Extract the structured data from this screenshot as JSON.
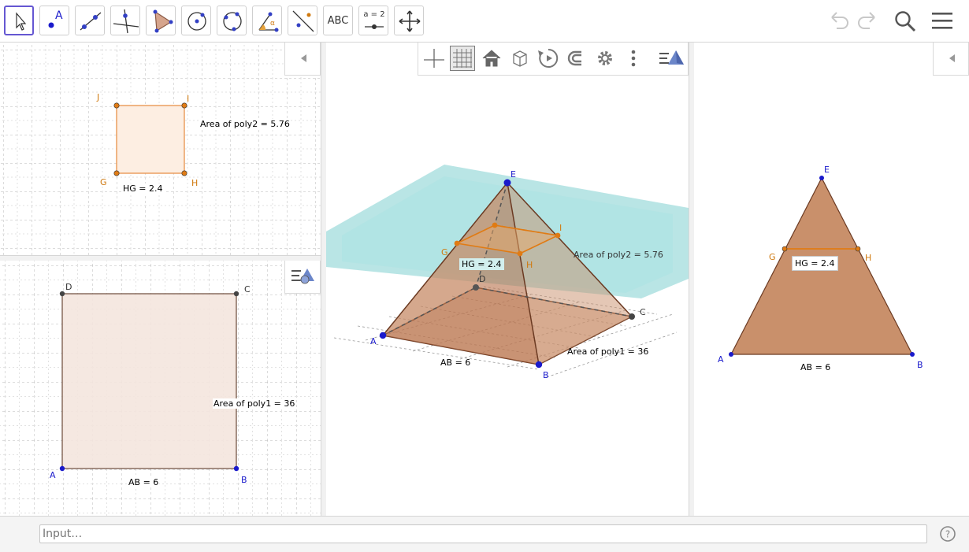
{
  "toolbar": {
    "tools": [
      {
        "name": "move-tool"
      },
      {
        "name": "point-tool",
        "label": "A"
      },
      {
        "name": "line-tool"
      },
      {
        "name": "perpendicular-line-tool"
      },
      {
        "name": "polygon-tool"
      },
      {
        "name": "circle-center-point-tool"
      },
      {
        "name": "circle-three-points-tool"
      },
      {
        "name": "angle-tool",
        "label": "α"
      },
      {
        "name": "reflect-tool"
      },
      {
        "name": "text-tool",
        "label": "ABC"
      },
      {
        "name": "slider-tool",
        "label": "a = 2"
      },
      {
        "name": "move-graphics-view-tool"
      }
    ]
  },
  "views": {
    "top_left": {
      "points": {
        "J": "J",
        "I": "I",
        "G": "G",
        "H": "H"
      },
      "area_label": "Area of poly2 = 5.76",
      "segment_label": "HG = 2.4"
    },
    "bottom_left": {
      "points": {
        "D": "D",
        "C": "C",
        "A": "A",
        "B": "B"
      },
      "area_label": "Area of poly1 = 36",
      "segment_label": "AB = 6"
    },
    "center_3d": {
      "points": {
        "E": "E",
        "G": "G",
        "I": "I",
        "H": "H",
        "D": "D",
        "A": "A",
        "B": "B",
        "C": "C"
      },
      "hg_label": "HG = 2.4",
      "area2_label": "Area of poly2 = 5.76",
      "ab_label": "AB = 6",
      "area1_label": "Area of poly1 = 36"
    },
    "right": {
      "points": {
        "E": "E",
        "G": "G",
        "H": "H",
        "A": "A",
        "B": "B"
      },
      "hg_label": "HG = 2.4",
      "ab_label": "AB = 6"
    }
  },
  "input": {
    "placeholder": "Input…"
  },
  "colors": {
    "accent": "#6557d2",
    "point_blue": "#1a1acb",
    "orange": "#e07b14",
    "fill_brown": "#c9906b",
    "plane": "#7fd0cf"
  }
}
